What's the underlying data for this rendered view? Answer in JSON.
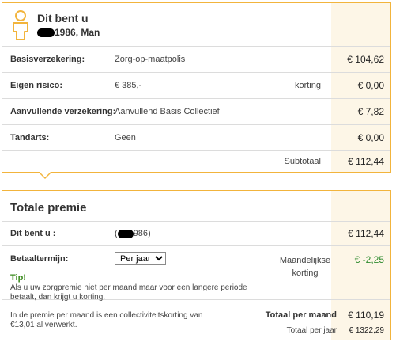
{
  "person": {
    "title": "Dit bent u",
    "birth_suffix": "1986, Man"
  },
  "rows": [
    {
      "label": "Basisverzekering:",
      "value": "Zorg-op-maatpolis",
      "middle": "",
      "amount": "€ 104,62"
    },
    {
      "label": "Eigen risico:",
      "value": "€ 385,-",
      "middle": "korting",
      "amount": "€ 0,00"
    },
    {
      "label": "Aanvullende verzekering:",
      "value": "Aanvullend Basis Collectief",
      "middle": "",
      "amount": "€ 7,82"
    },
    {
      "label": "Tandarts:",
      "value": "Geen",
      "middle": "",
      "amount": "€ 0,00"
    }
  ],
  "subtotal": {
    "label": "Subtotaal",
    "amount": "€ 112,44"
  },
  "totale": {
    "title": "Totale premie",
    "dit_bent_u_label": "Dit bent u :",
    "dit_bent_u_value_open": "(",
    "dit_bent_u_value_close": "986)",
    "dit_bent_u_amount": "€ 112,44",
    "betaaltermijn_label": "Betaaltermijn:",
    "betaaltermijn_selected": "Per jaar",
    "korting_label_line1": "Maandelijkse",
    "korting_label_line2": "korting",
    "korting_amount": "€ -2,25",
    "tip_label": "Tip!",
    "tip_text": "Als u uw zorgpremie niet per maand maar voor een langere periode betaalt, dan krijgt u korting.",
    "footer_note": "In de premie per maand is een collectiviteitskorting van €13,01 al verwerkt.",
    "total_month_label": "Totaal per maand",
    "total_month_amount": "€ 110,19",
    "total_year_label": "Totaal per jaar",
    "total_year_amount": "€ 1322,29"
  },
  "colors": {
    "border": "#f2b43c",
    "shade": "#fdf6e7",
    "green": "#2e8b2e"
  }
}
